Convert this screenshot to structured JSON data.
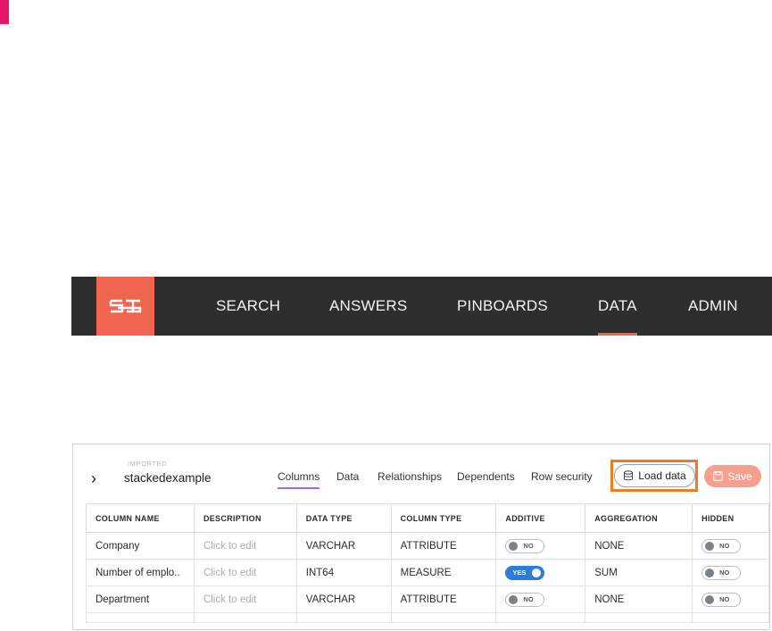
{
  "nav": {
    "items": [
      {
        "label": "SEARCH"
      },
      {
        "label": "ANSWERS"
      },
      {
        "label": "PINBOARDS"
      },
      {
        "label": "DATA"
      },
      {
        "label": "ADMIN"
      }
    ],
    "active": "DATA",
    "accent_color": "#ef6550"
  },
  "panel": {
    "imported_label": "IMPORTED",
    "table_name": "stackedexample",
    "tabs": [
      {
        "label": "Columns"
      },
      {
        "label": "Data"
      },
      {
        "label": "Relationships"
      },
      {
        "label": "Dependents"
      },
      {
        "label": "Row security"
      }
    ],
    "active_tab": "Columns",
    "load_data_label": "Load data",
    "save_label": "Save"
  },
  "table": {
    "headers": [
      "COLUMN NAME",
      "DESCRIPTION",
      "DATA TYPE",
      "COLUMN TYPE",
      "ADDITIVE",
      "AGGREGATION",
      "HIDDEN"
    ],
    "rows": [
      {
        "name": "Company",
        "description": "Click to edit",
        "data_type": "VARCHAR",
        "column_type": "ATTRIBUTE",
        "additive": "NO",
        "aggregation": "NONE",
        "hidden": "NO"
      },
      {
        "name": "Number of emplo..",
        "description": "Click to edit",
        "data_type": "INT64",
        "column_type": "MEASURE",
        "additive": "YES",
        "aggregation": "SUM",
        "hidden": "NO"
      },
      {
        "name": "Department",
        "description": "Click to edit",
        "data_type": "VARCHAR",
        "column_type": "ATTRIBUTE",
        "additive": "NO",
        "aggregation": "NONE",
        "hidden": "NO"
      }
    ]
  }
}
